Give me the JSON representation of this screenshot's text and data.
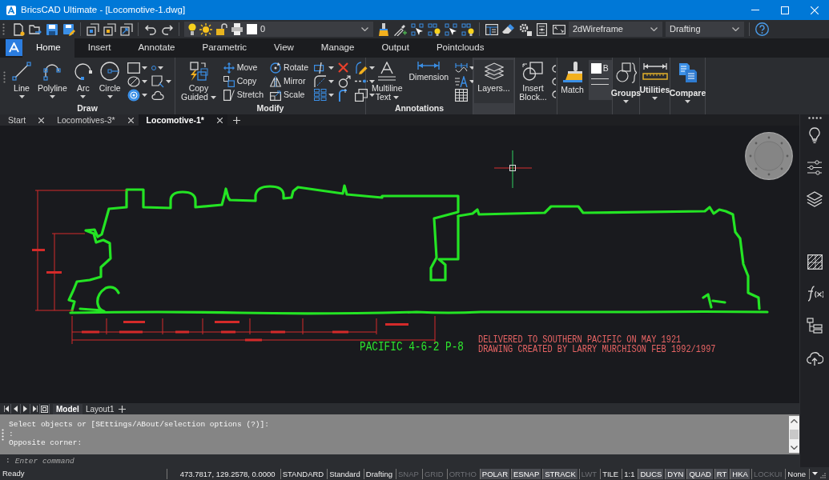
{
  "window": {
    "title": "BricsCAD Ultimate - [Locomotive-1.dwg]"
  },
  "quick_access": {
    "layer": "0",
    "visual_style": "2dWireframe",
    "workspace": "Drafting"
  },
  "ribbon": {
    "tabs": [
      {
        "label": "Home",
        "selected": true
      },
      {
        "label": "Insert",
        "selected": false
      },
      {
        "label": "Annotate",
        "selected": false
      },
      {
        "label": "Parametric",
        "selected": false
      },
      {
        "label": "View",
        "selected": false
      },
      {
        "label": "Manage",
        "selected": false
      },
      {
        "label": "Output",
        "selected": false
      },
      {
        "label": "Pointclouds",
        "selected": false
      }
    ],
    "panels": [
      {
        "title": "Draw",
        "highlighted": false,
        "buttons": [
          {
            "kind": "large",
            "label": "Line",
            "dropdown": true
          },
          {
            "kind": "large",
            "label": "Polyline",
            "dropdown": true
          },
          {
            "kind": "large",
            "label": "Arc",
            "dropdown": true
          },
          {
            "kind": "large",
            "label": "Circle",
            "dropdown": true
          }
        ]
      },
      {
        "title": "Modify",
        "highlighted": false,
        "buttons": [
          {
            "kind": "large",
            "label": "Copy Guided",
            "dropdown": true
          },
          {
            "kind": "small",
            "label": "Move"
          },
          {
            "kind": "small",
            "label": "Copy"
          },
          {
            "kind": "small",
            "label": "Stretch"
          },
          {
            "kind": "small",
            "label": "Rotate"
          },
          {
            "kind": "small",
            "label": "Mirror"
          },
          {
            "kind": "small",
            "label": "Scale"
          }
        ]
      },
      {
        "title": "Annotations",
        "highlighted": false,
        "buttons": [
          {
            "kind": "large",
            "label": "Multiline Text",
            "dropdown": true
          },
          {
            "kind": "large",
            "label": "Dimension",
            "dropdown": false
          }
        ]
      },
      {
        "highlighted": true,
        "buttons": [
          {
            "kind": "large",
            "label": "Layers...",
            "dropdown": false
          }
        ]
      },
      {
        "highlighted": false,
        "buttons": [
          {
            "kind": "large",
            "label": "Insert Block...",
            "dropdown": false
          }
        ]
      },
      {
        "highlighted": false,
        "buttons": [
          {
            "kind": "large",
            "label": "Match",
            "dropdown": false
          },
          {
            "kind": "property",
            "label": "B"
          }
        ]
      },
      {
        "highlighted": false,
        "buttons": [
          {
            "kind": "collapsed",
            "label": "Groups",
            "dropdown": true
          }
        ]
      },
      {
        "highlighted": false,
        "buttons": [
          {
            "kind": "collapsed",
            "label": "Utilities",
            "dropdown": true
          }
        ]
      },
      {
        "highlighted": false,
        "buttons": [
          {
            "kind": "collapsed",
            "label": "Compare",
            "dropdown": true
          }
        ]
      }
    ]
  },
  "document_tabs": [
    {
      "label": "Start",
      "selected": false
    },
    {
      "label": "Locomotives-3*",
      "selected": false
    },
    {
      "label": "Locomotive-1*",
      "selected": true
    }
  ],
  "drawing": {
    "labels": [
      {
        "kind": "title",
        "text": "PACIFIC 4-6-2 P-8"
      },
      {
        "kind": "note",
        "text": "DELIVERED TO SOUTHERN PACIFIC ON MAY 1921"
      },
      {
        "kind": "note",
        "text": "DRAWING CREATED BY LARRY MURCHISON FEB 1992/1997"
      }
    ]
  },
  "layout_tabs": [
    {
      "label": "Model",
      "selected": true
    },
    {
      "label": "Layout1",
      "selected": false
    }
  ],
  "command_line": {
    "history": [
      "Select objects or [SEttings/ABout/selection options (?)]:",
      ":",
      "Opposite corner:"
    ],
    "prompt": ":",
    "placeholder": "Enter command"
  },
  "status_bar": {
    "message": "Ready",
    "coordinates": "473.7817, 129.2578, 0.0000",
    "items": [
      {
        "kind": "field",
        "label": "STANDARD"
      },
      {
        "kind": "field",
        "label": "Standard"
      },
      {
        "kind": "field",
        "label": "Drafting"
      },
      {
        "kind": "toggle",
        "label": "SNAP",
        "on": false
      },
      {
        "kind": "toggle",
        "label": "GRID",
        "on": false
      },
      {
        "kind": "toggle",
        "label": "ORTHO",
        "on": false
      },
      {
        "kind": "toggle",
        "label": "POLAR",
        "on": true
      },
      {
        "kind": "toggle",
        "label": "ESNAP",
        "on": true
      },
      {
        "kind": "toggle",
        "label": "STRACK",
        "on": true
      },
      {
        "kind": "toggle",
        "label": "LWT",
        "on": false
      },
      {
        "kind": "field",
        "label": "TILE"
      },
      {
        "kind": "field",
        "label": "1:1"
      },
      {
        "kind": "toggle",
        "label": "DUCS",
        "on": true
      },
      {
        "kind": "toggle",
        "label": "DYN",
        "on": true
      },
      {
        "kind": "toggle",
        "label": "QUAD",
        "on": true
      },
      {
        "kind": "toggle",
        "label": "RT",
        "on": true
      },
      {
        "kind": "toggle",
        "label": "HKA",
        "on": true
      },
      {
        "kind": "toggle",
        "label": "LOCKUI",
        "on": false
      },
      {
        "kind": "field",
        "label": "None"
      }
    ]
  }
}
